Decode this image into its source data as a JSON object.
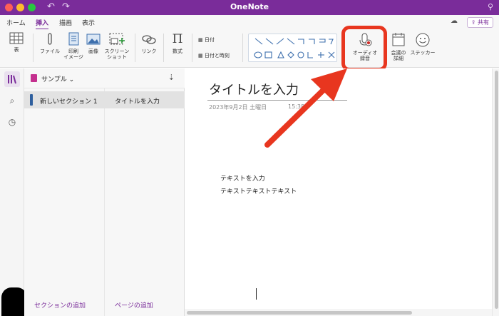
{
  "window": {
    "title": "OneNote"
  },
  "tabs": [
    {
      "label": "ホーム"
    },
    {
      "label": "挿入"
    },
    {
      "label": "描画"
    },
    {
      "label": "表示"
    }
  ],
  "share_label": "共有",
  "ribbon": {
    "table": "表",
    "file": "ファイル",
    "print_image_1": "印刷",
    "print_image_2": "イメージ",
    "picture": "画像",
    "screenshot_1": "スクリーン",
    "screenshot_2": "ショット",
    "link": "リンク",
    "equation": "数式",
    "date": "日付",
    "date_time": "日付と時刻",
    "audio_1": "オーディオ",
    "audio_2": "録音",
    "meeting_1": "会議の",
    "meeting_2": "詳細",
    "sticker": "ステッカー"
  },
  "notebook": {
    "name": "サンプル"
  },
  "sections": [
    {
      "label": "新しいセクション 1"
    }
  ],
  "pages": [
    {
      "label": "タイトルを入力"
    }
  ],
  "add_section": "セクションの追加",
  "add_page": "ページの追加",
  "page": {
    "title": "タイトルを入力",
    "date": "2023年9月2日 土曜日",
    "time": "15:38",
    "lines": [
      "テキストを入力",
      "テキストテキストテキスト"
    ]
  },
  "colors": {
    "brand": "#7a2c9a",
    "annotation": "#e8361f"
  }
}
